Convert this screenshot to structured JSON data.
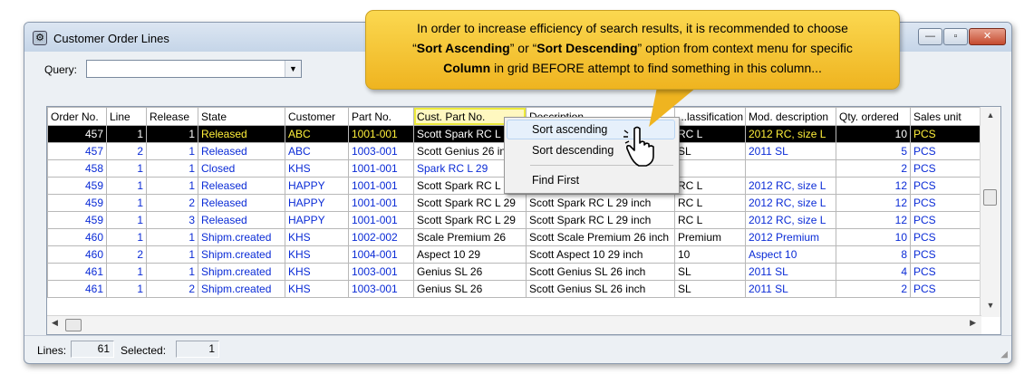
{
  "window": {
    "title": "Customer Order Lines",
    "buttons": {
      "minimize": "—",
      "maximize": "▫",
      "close": "✕"
    }
  },
  "query": {
    "label": "Query:",
    "value": ""
  },
  "grid": {
    "columns": [
      "Order No.",
      "Line",
      "Release",
      "State",
      "Customer",
      "Part No.",
      "Cust. Part No.",
      "Description",
      "Classification",
      "Mod. description",
      "Qty. ordered",
      "Sales unit"
    ],
    "header_visible": [
      "Order No.",
      "Line",
      "Release",
      "State",
      "Customer",
      "Part No.",
      "Cust. Part No.",
      "Description ...",
      "...lassification",
      "Mod. description",
      "Qty. ordered",
      "Sales unit"
    ],
    "rows": [
      [
        "457",
        "1",
        "1",
        "Released",
        "ABC",
        "1001-001",
        "Scott Spark RC L",
        "",
        "RC L",
        "2012 RC, size L",
        "10",
        "PCS"
      ],
      [
        "457",
        "2",
        "1",
        "Released",
        "ABC",
        "1003-001",
        "Scott Genius 26 in",
        "",
        "SL",
        "2011 SL",
        "5",
        "PCS"
      ],
      [
        "458",
        "1",
        "1",
        "Closed",
        "KHS",
        "1001-001",
        "Spark RC L 29",
        "",
        "",
        "",
        "2",
        "PCS"
      ],
      [
        "459",
        "1",
        "1",
        "Released",
        "HAPPY",
        "1001-001",
        "Scott Spark RC L",
        "",
        "RC L",
        "2012 RC, size L",
        "12",
        "PCS"
      ],
      [
        "459",
        "1",
        "2",
        "Released",
        "HAPPY",
        "1001-001",
        "Scott Spark RC L 29",
        "Scott Spark RC L 29 inch",
        "RC L",
        "2012 RC, size L",
        "12",
        "PCS"
      ],
      [
        "459",
        "1",
        "3",
        "Released",
        "HAPPY",
        "1001-001",
        "Scott Spark RC L 29",
        "Scott Spark RC L 29 inch",
        "RC L",
        "2012 RC, size L",
        "12",
        "PCS"
      ],
      [
        "460",
        "1",
        "1",
        "Shipm.created",
        "KHS",
        "1002-002",
        "Scale Premium 26",
        "Scott Scale Premium 26 inch",
        "Premium",
        "2012 Premium",
        "10",
        "PCS"
      ],
      [
        "460",
        "2",
        "1",
        "Shipm.created",
        "KHS",
        "1004-001",
        "Aspect 10 29",
        "Scott Aspect 10 29 inch",
        "10",
        "Aspect 10",
        "8",
        "PCS"
      ],
      [
        "461",
        "1",
        "1",
        "Shipm.created",
        "KHS",
        "1003-001",
        "Genius SL 26",
        "Scott Genius SL 26 inch",
        "SL",
        "2011 SL",
        "4",
        "PCS"
      ],
      [
        "461",
        "1",
        "2",
        "Shipm.created",
        "KHS",
        "1003-001",
        "Genius SL 26",
        "Scott Genius SL 26 inch",
        "SL",
        "2011 SL",
        "2",
        "PCS"
      ]
    ]
  },
  "context_menu": {
    "items": [
      "Sort ascending",
      "Sort descending",
      "Find First"
    ]
  },
  "status": {
    "lines_label": "Lines:",
    "lines_value": "61",
    "selected_label": "Selected:",
    "selected_value": "1"
  },
  "callout": {
    "line1": "In order to increase efficiency of search results, it is recommended to choose",
    "q1": "“",
    "b1": "Sort Ascending",
    "q2": "” or “",
    "b2": "Sort Descending",
    "q3": "” option from context menu for specific",
    "b3": "Column",
    "line3": " in grid BEFORE attempt to find something in this column..."
  },
  "colors": {
    "selected_row_bg": "#000000",
    "selected_text_yellow": "#ffef3a",
    "link_blue": "#0a2bd6",
    "callout": "#f4c430"
  }
}
